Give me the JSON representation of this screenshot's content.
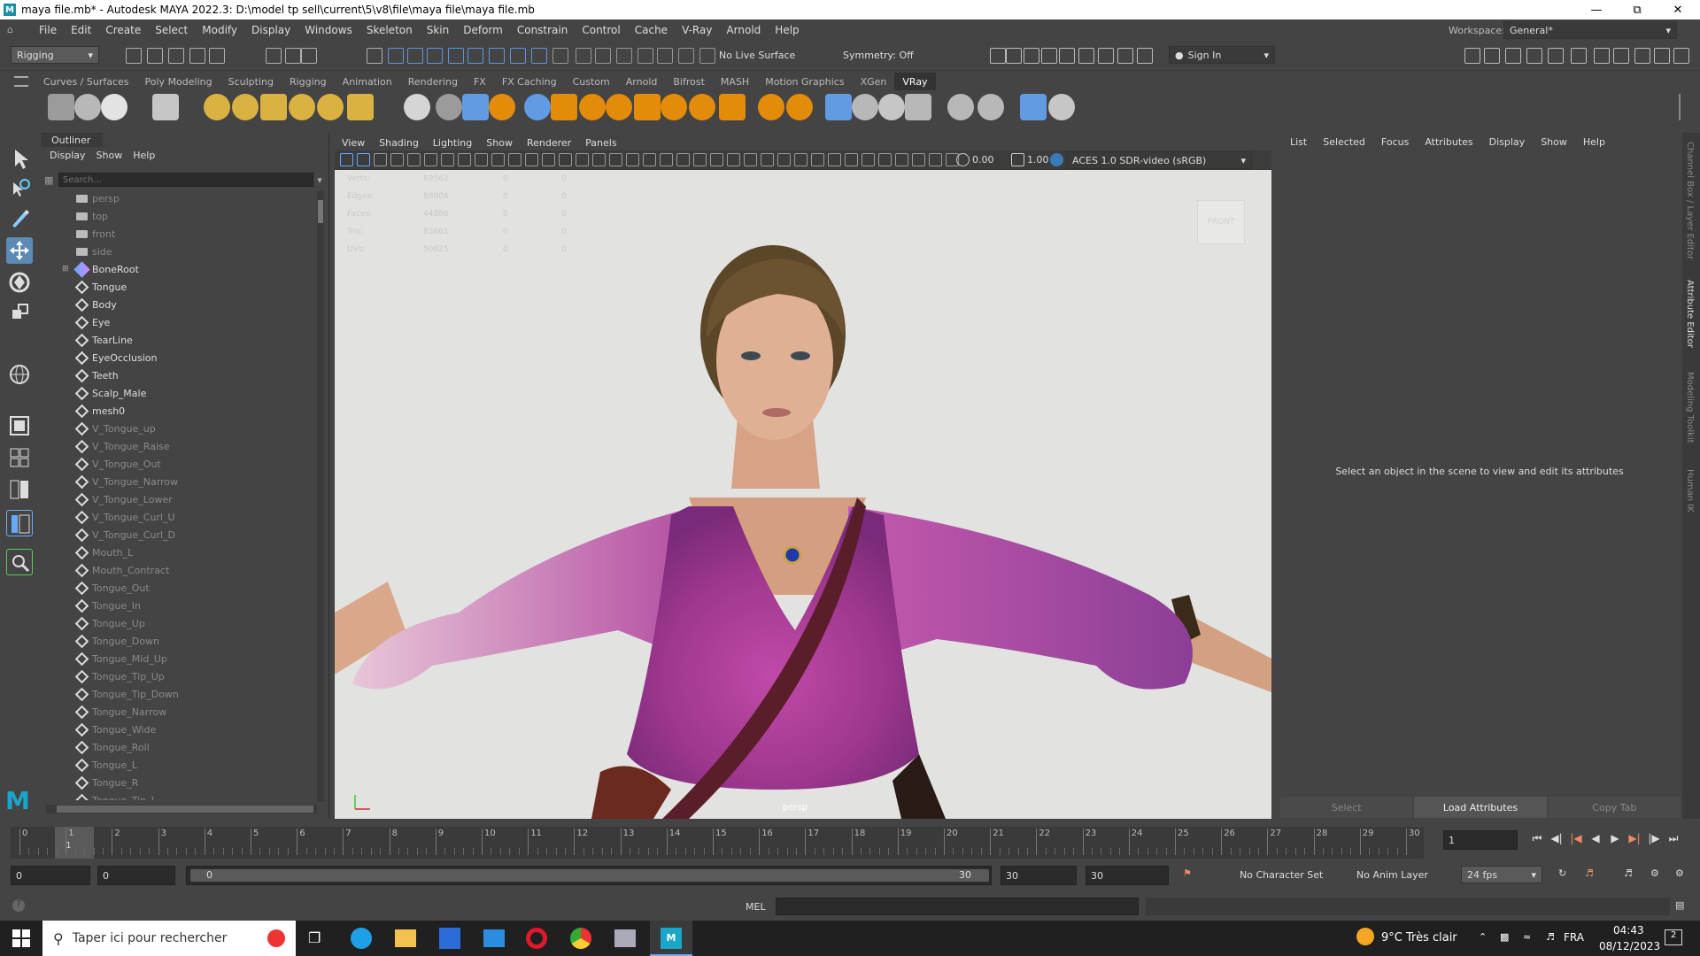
{
  "window": {
    "title": "maya file.mb* - Autodesk MAYA 2022.3: D:\\model tp sell\\current\\5\\v8\\file\\maya file\\maya file.mb"
  },
  "menubar": {
    "items": [
      "File",
      "Edit",
      "Create",
      "Select",
      "Modify",
      "Display",
      "Windows",
      "Skeleton",
      "Skin",
      "Deform",
      "Constrain",
      "Control",
      "Cache",
      "V-Ray",
      "Arnold",
      "Help"
    ],
    "workspace_label": "Workspace:",
    "workspace_value": "General*"
  },
  "statusline": {
    "mode": "Rigging",
    "live_surface": "No Live Surface",
    "symmetry": "Symmetry: Off",
    "sign_in": "Sign In"
  },
  "shelf": {
    "tabs": [
      "Curves / Surfaces",
      "Poly Modeling",
      "Sculpting",
      "Rigging",
      "Animation",
      "Rendering",
      "FX",
      "FX Caching",
      "Custom",
      "Arnold",
      "Bifrost",
      "MASH",
      "Motion Graphics",
      "XGen",
      "VRay"
    ],
    "active_tab": "VRay"
  },
  "outliner": {
    "title": "Outliner",
    "menu": [
      "Display",
      "Show",
      "Help"
    ],
    "search_placeholder": "Search...",
    "items": [
      {
        "label": "persp",
        "kind": "camera",
        "dim": true
      },
      {
        "label": "top",
        "kind": "camera",
        "dim": true
      },
      {
        "label": "front",
        "kind": "camera",
        "dim": true
      },
      {
        "label": "side",
        "kind": "camera",
        "dim": true
      },
      {
        "label": "BoneRoot",
        "kind": "joint",
        "dim": false
      },
      {
        "label": "Tongue",
        "kind": "mesh",
        "dim": false
      },
      {
        "label": "Body",
        "kind": "mesh",
        "dim": false
      },
      {
        "label": "Eye",
        "kind": "mesh",
        "dim": false
      },
      {
        "label": "TearLine",
        "kind": "mesh",
        "dim": false
      },
      {
        "label": "EyeOcclusion",
        "kind": "mesh",
        "dim": false
      },
      {
        "label": "Teeth",
        "kind": "mesh",
        "dim": false
      },
      {
        "label": "Scalp_Male",
        "kind": "mesh",
        "dim": false
      },
      {
        "label": "mesh0",
        "kind": "mesh",
        "dim": false
      },
      {
        "label": "V_Tongue_up",
        "kind": "mesh",
        "dim": true
      },
      {
        "label": "V_Tongue_Raise",
        "kind": "mesh",
        "dim": true
      },
      {
        "label": "V_Tongue_Out",
        "kind": "mesh",
        "dim": true
      },
      {
        "label": "V_Tongue_Narrow",
        "kind": "mesh",
        "dim": true
      },
      {
        "label": "V_Tongue_Lower",
        "kind": "mesh",
        "dim": true
      },
      {
        "label": "V_Tongue_Curl_U",
        "kind": "mesh",
        "dim": true
      },
      {
        "label": "V_Tongue_Curl_D",
        "kind": "mesh",
        "dim": true
      },
      {
        "label": "Mouth_L",
        "kind": "mesh",
        "dim": true
      },
      {
        "label": "Mouth_Contract",
        "kind": "mesh",
        "dim": true
      },
      {
        "label": "Tongue_Out",
        "kind": "mesh",
        "dim": true
      },
      {
        "label": "Tongue_In",
        "kind": "mesh",
        "dim": true
      },
      {
        "label": "Tongue_Up",
        "kind": "mesh",
        "dim": true
      },
      {
        "label": "Tongue_Down",
        "kind": "mesh",
        "dim": true
      },
      {
        "label": "Tongue_Mid_Up",
        "kind": "mesh",
        "dim": true
      },
      {
        "label": "Tongue_Tip_Up",
        "kind": "mesh",
        "dim": true
      },
      {
        "label": "Tongue_Tip_Down",
        "kind": "mesh",
        "dim": true
      },
      {
        "label": "Tongue_Narrow",
        "kind": "mesh",
        "dim": true
      },
      {
        "label": "Tongue_Wide",
        "kind": "mesh",
        "dim": true
      },
      {
        "label": "Tongue_Roll",
        "kind": "mesh",
        "dim": true
      },
      {
        "label": "Tongue_L",
        "kind": "mesh",
        "dim": true
      },
      {
        "label": "Tongue_R",
        "kind": "mesh",
        "dim": true
      },
      {
        "label": "Tongue_Tip_L",
        "kind": "mesh",
        "dim": true
      }
    ]
  },
  "viewport": {
    "menu": [
      "View",
      "Shading",
      "Lighting",
      "Show",
      "Renderer",
      "Panels"
    ],
    "exposure": "0.00",
    "gamma": "1.00",
    "color_space": "ACES 1.0 SDR-video (sRGB)",
    "camera_label": "persp",
    "view_cube": "FRONT",
    "hud": [
      {
        "label": "Verts:",
        "v1": "69562",
        "v2": "0",
        "v3": "0"
      },
      {
        "label": "Edges:",
        "v1": "88904",
        "v2": "0",
        "v3": "0"
      },
      {
        "label": "Faces:",
        "v1": "44886",
        "v2": "0",
        "v3": "0"
      },
      {
        "label": "Tris:",
        "v1": "83661",
        "v2": "0",
        "v3": "0"
      },
      {
        "label": "UVs:",
        "v1": "50825",
        "v2": "0",
        "v3": "0"
      }
    ]
  },
  "attribute_editor": {
    "menu": [
      "List",
      "Selected",
      "Focus",
      "Attributes",
      "Display",
      "Show",
      "Help"
    ],
    "message": "Select an object in the scene to view and edit its attributes",
    "buttons": [
      "Select",
      "Load Attributes",
      "Copy Tab"
    ]
  },
  "side_tabs": [
    "Channel Box / Layer Editor",
    "Attribute Editor",
    "Modeling Toolkit",
    "Human IK"
  ],
  "timeline": {
    "ticks": [
      "0",
      "1",
      "2",
      "3",
      "4",
      "5",
      "6",
      "7",
      "8",
      "9",
      "10",
      "11",
      "12",
      "13",
      "14",
      "15",
      "16",
      "17",
      "18",
      "19",
      "20",
      "21",
      "22",
      "23",
      "24",
      "25",
      "26",
      "27",
      "28",
      "29",
      "30"
    ],
    "current_marker": "1",
    "current_frame": "1"
  },
  "range": {
    "start": "0",
    "anim_start": "0",
    "slider_start": "0",
    "slider_end": "30",
    "end": "30",
    "anim_end": "30",
    "character_set": "No Character Set",
    "anim_layer": "No Anim Layer",
    "fps": "24 fps"
  },
  "cmdline": {
    "label": "MEL"
  },
  "taskbar": {
    "search": "Taper ici pour rechercher",
    "weather": "9°C  Très clair",
    "lang": "FRA",
    "time": "04:43",
    "date": "08/12/2023",
    "notif": "2"
  }
}
